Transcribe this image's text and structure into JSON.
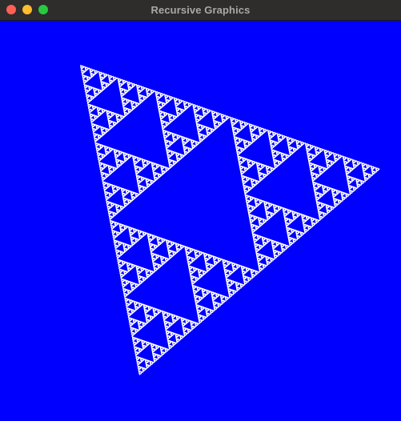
{
  "window": {
    "title": "Recursive Graphics",
    "buttons": [
      {
        "name": "close-button",
        "color": "#fe5f57"
      },
      {
        "name": "minimize-button",
        "color": "#febc2e"
      },
      {
        "name": "zoom-button",
        "color": "#28c840"
      }
    ]
  },
  "canvas": {
    "background_color": "#0000ff",
    "figure": "sierpinski-triangle",
    "figure_color": "#ffffff",
    "recursion_depth": 7
  }
}
